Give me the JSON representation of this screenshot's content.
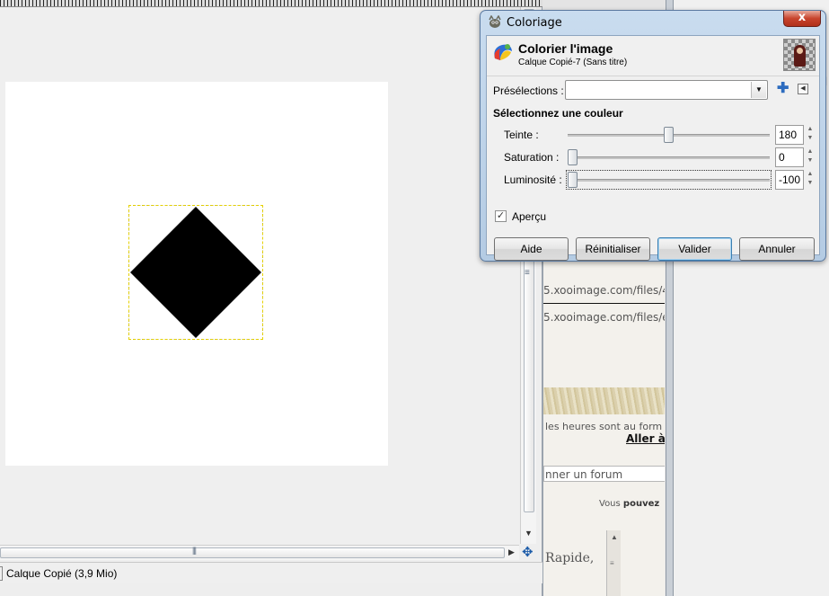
{
  "image_window": {
    "status_label": "Calque Copié (3,9 Mio)"
  },
  "dialog": {
    "window_title": "Coloriage",
    "close_label": "x",
    "header_title": "Colorier l'image",
    "header_subtitle": "Calque Copié-7 (Sans titre)",
    "presets_label": "Présélections :",
    "presets_value": "",
    "section_label": "Sélectionnez une couleur",
    "sliders": [
      {
        "label": "Teinte :",
        "value": "180",
        "min": 0,
        "max": 360,
        "level": 180
      },
      {
        "label": "Saturation :",
        "value": "0",
        "min": 0,
        "max": 100,
        "level": 0
      },
      {
        "label": "Luminosité :",
        "value": "-100",
        "min": -100,
        "max": 100,
        "level": -100
      }
    ],
    "preview_label": "Aperçu",
    "preview_checked": true,
    "buttons": {
      "help": "Aide",
      "reset": "Réinitialiser",
      "ok": "Valider",
      "cancel": "Annuler"
    }
  },
  "web_page": {
    "url_1": "5.xooimage.com/files/4/",
    "url_2": "5.xooimage.com/files/e/",
    "hours_text": "les heures sont au form",
    "goto_link": "Aller à",
    "forum_select": "nner un forum",
    "you_can_prefix": "Vous ",
    "you_can_bold": "pouvez",
    "quick_text": "Rapide,"
  },
  "colors": {
    "dialog_frame": "#b4cbe3",
    "close_button": "#c8442d",
    "default_button_border": "#3c7fb1"
  }
}
